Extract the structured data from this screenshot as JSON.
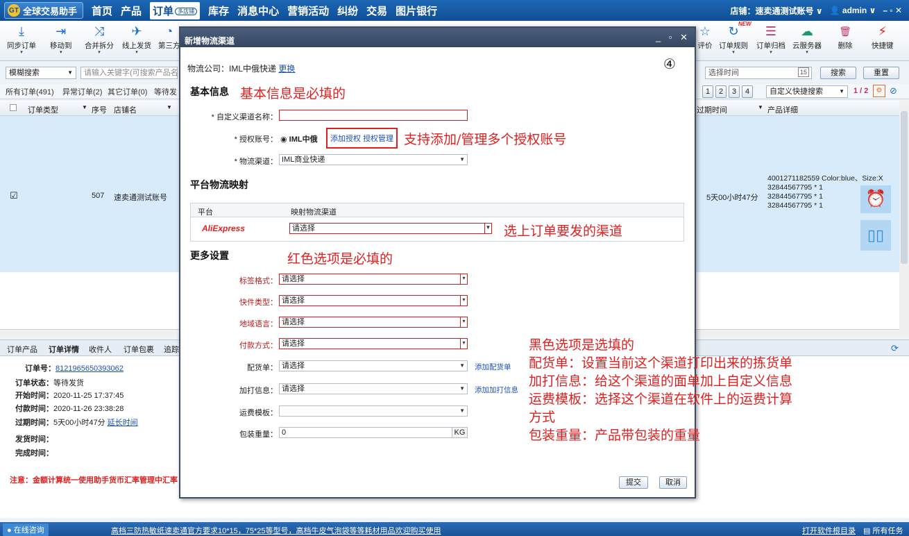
{
  "app": {
    "title": "全球交易助手",
    "logo_text": "GT"
  },
  "nav": [
    {
      "label": "首页"
    },
    {
      "label": "产品"
    },
    {
      "label": "订单",
      "tag": "多店铺",
      "active": true
    },
    {
      "label": "库存"
    },
    {
      "label": "消息中心"
    },
    {
      "label": "营销活动"
    },
    {
      "label": "纠纷"
    },
    {
      "label": "交易"
    },
    {
      "label": "图片银行"
    }
  ],
  "topright": {
    "shop": "店铺：速卖通测试账号",
    "user": "admin",
    "win": "– ▫ ✕"
  },
  "toolbar_left": [
    {
      "label": "同步订单",
      "icon": "⤓"
    },
    {
      "label": "移动到",
      "icon": "⇥"
    },
    {
      "label": "合并拆分",
      "icon": "⤨"
    },
    {
      "label": "线上发货",
      "icon": "✈"
    },
    {
      "label": "第三方",
      "icon": "◔"
    }
  ],
  "toolbar_right": [
    {
      "label": "评价",
      "icon": "☆"
    },
    {
      "label": "订单规则",
      "icon": "↻",
      "badge": "NEW"
    },
    {
      "label": "订单归档",
      "icon": "☰"
    },
    {
      "label": "云服务器",
      "icon": "☁"
    },
    {
      "label": "删除",
      "icon": "🗑"
    },
    {
      "label": "快捷键",
      "icon": "⚡"
    }
  ],
  "search": {
    "mode": "模糊搜索",
    "placeholder": "请输入关键字(可搜索产品名",
    "time": "选择时间",
    "cal": "15",
    "search_btn": "搜索",
    "reset_btn": "重置"
  },
  "order_tabs": [
    "所有订单(491)",
    "异常订单(2)",
    "其它订单(0)",
    "等待发"
  ],
  "pager": {
    "pages": [
      "1",
      "2",
      "3",
      "4"
    ],
    "quick": "自定义快捷搜索",
    "page": "1 / 2"
  },
  "grid": {
    "headers": [
      "订单类型",
      "序号",
      "店铺名",
      "过期时间",
      "产品详细"
    ],
    "row": {
      "check": "☑",
      "seq": "507",
      "shop": "速卖通测试账号",
      "expire": "5天00小时47分",
      "products": [
        "4001271182559  Color:blue、Size:X",
        "32844567795  * 1",
        "32844567795  * 1",
        "32844567795  * 1"
      ]
    }
  },
  "detail_tabs": [
    "订单产品",
    "订单详情",
    "收件人",
    "订单包裹",
    "追踪"
  ],
  "detail": {
    "order_no_label": "订单号：",
    "order_no": "8121965650393062",
    "status_label": "订单状态：",
    "status": "等待发货",
    "start_label": "开始时间：",
    "start": "2020-11-25 17:37:45",
    "pay_label": "付款时间：",
    "pay": "2020-11-26 23:38:28",
    "expire_label": "过期时间：",
    "expire": "5天00小时47分",
    "extend": "延长时间",
    "ship_label": "发货时间：",
    "done_label": "完成时间：",
    "note": "注意：金额计算统一使用助手货币汇率管理中汇率"
  },
  "status": {
    "consult": "在线咨询",
    "ad": "高档三防热敏纸速卖通官方要求10*15，75*25等型号，高档牛皮气泡袋等等耗材用品欢迎购买使用",
    "open_dir": "打开软件根目录",
    "tasks": "所有任务"
  },
  "dialog": {
    "title": "新增物流渠道",
    "step": "④",
    "company": "物流公司：IML中俄快递",
    "change": "更换",
    "basic": "基本信息",
    "ann_basic": "基本信息是必填的",
    "name_label": "* 自定义渠道名称：",
    "auth_label": "* 授权账号：",
    "auth_value": "IML中俄",
    "auth_add": "添加授权",
    "auth_manage": "授权管理",
    "ann_auth": "支持添加/管理多个授权账号",
    "channel_label": "* 物流渠道：",
    "channel_value": "IML商业快递",
    "map_title": "平台物流映射",
    "map_head": [
      "平台",
      "映射物流渠道"
    ],
    "platform": "AliExpress",
    "map_value": "请选择",
    "ann_map": "选上订单要发的渠道",
    "more": "更多设置",
    "ann_more": "红色选项是必填的",
    "red_fields": [
      {
        "label": "标签格式：",
        "value": "请选择"
      },
      {
        "label": "快件类型：",
        "value": "请选择"
      },
      {
        "label": "地域语言：",
        "value": "请选择"
      },
      {
        "label": "付款方式：",
        "value": "请选择"
      }
    ],
    "pick_label": "配货单：",
    "pick_value": "请选择",
    "pick_add": "添加配货单",
    "print_label": "加打信息：",
    "print_value": "请选择",
    "print_add": "添加加打信息",
    "fee_label": "运费模板：",
    "weight_label": "包装重量：",
    "weight_value": "0",
    "weight_unit": "KG",
    "submit": "提交",
    "cancel": "取消"
  },
  "annotations_black": [
    "黑色选项是选填的",
    "配货单：设置当前这个渠道打印出来的拣货单",
    "加打信息：给这个渠道的面单加上自定义信息",
    "运费模板：选择这个渠道在软件上的运费计算",
    "方式",
    "包装重量：产品带包装的重量"
  ]
}
